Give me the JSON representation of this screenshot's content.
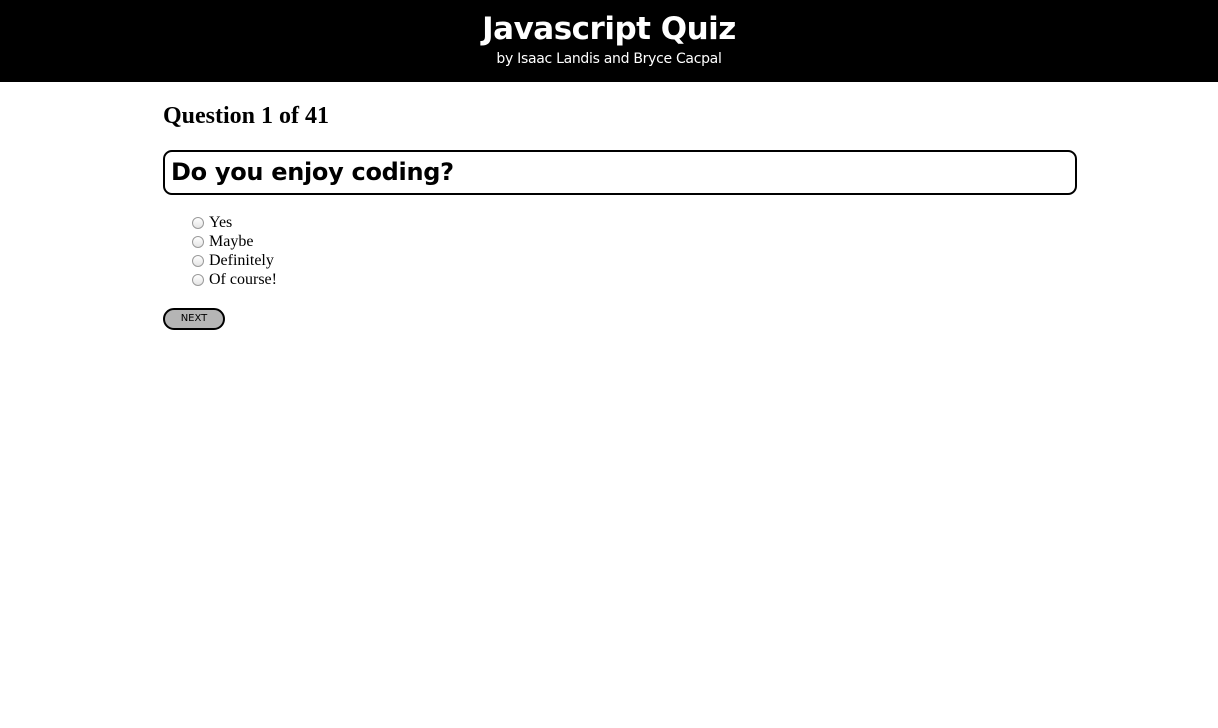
{
  "header": {
    "title": "Javascript Quiz",
    "subtitle": "by Isaac Landis and Bryce Cacpal"
  },
  "quiz": {
    "progress": "Question 1 of 41",
    "question": "Do you enjoy coding?",
    "options": [
      {
        "label": "Yes",
        "selected": false
      },
      {
        "label": "Maybe",
        "selected": false
      },
      {
        "label": "Definitely",
        "selected": false
      },
      {
        "label": "Of course!",
        "selected": false
      }
    ],
    "next_label": "NEXT"
  }
}
